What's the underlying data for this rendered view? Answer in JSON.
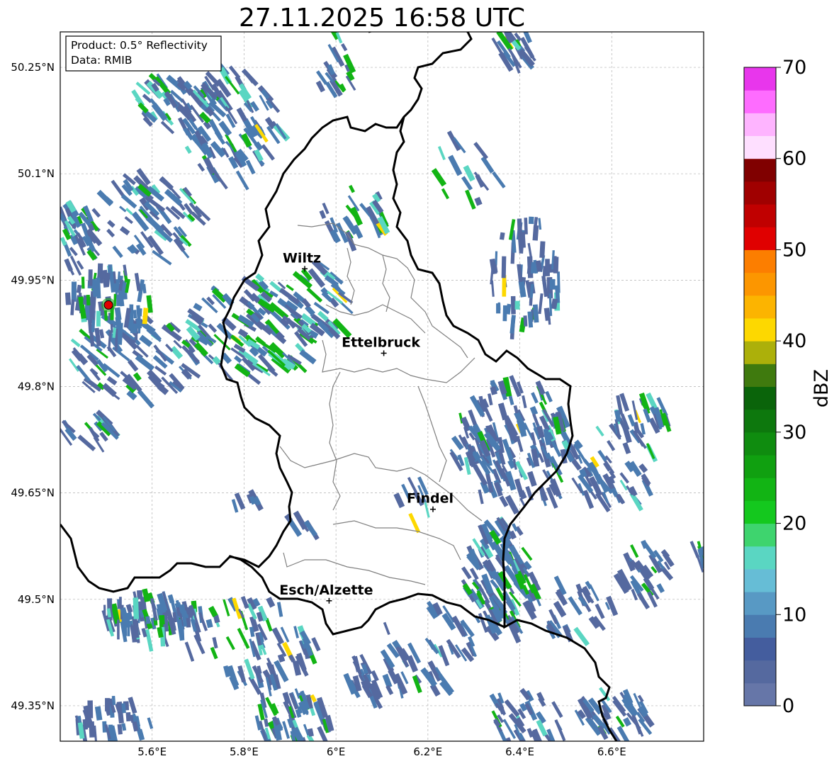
{
  "title": "27.11.2025 16:58 UTC",
  "info_box": {
    "line1": "Product: 0.5° Reflectivity",
    "line2": "Data: RMIB"
  },
  "map": {
    "lon_range": [
      5.4,
      6.8
    ],
    "lat_range": [
      49.3,
      50.3
    ],
    "lon_ticks": [
      {
        "v": 5.6,
        "label": "5.6°E"
      },
      {
        "v": 5.8,
        "label": "5.8°E"
      },
      {
        "v": 6.0,
        "label": "6°E"
      },
      {
        "v": 6.2,
        "label": "6.2°E"
      },
      {
        "v": 6.4,
        "label": "6.4°E"
      },
      {
        "v": 6.6,
        "label": "6.6°E"
      }
    ],
    "lat_ticks": [
      {
        "v": 50.25,
        "label": "50.25°N"
      },
      {
        "v": 50.1,
        "label": "50.1°N"
      },
      {
        "v": 49.95,
        "label": "49.95°N"
      },
      {
        "v": 49.8,
        "label": "49.8°N"
      },
      {
        "v": 49.65,
        "label": "49.65°N"
      },
      {
        "v": 49.5,
        "label": "49.5°N"
      },
      {
        "v": 49.35,
        "label": "49.35°N"
      }
    ],
    "radar_site": {
      "lon": 5.505,
      "lat": 49.915
    },
    "cities": [
      {
        "name": "Wiltz",
        "lon": 5.932,
        "lat": 49.966
      },
      {
        "name": "Ettelbruck",
        "lon": 6.104,
        "lat": 49.847
      },
      {
        "name": "Findel",
        "lon": 6.211,
        "lat": 49.627
      },
      {
        "name": "Esch/Alzette",
        "lon": 5.985,
        "lat": 49.498
      }
    ]
  },
  "colorbar": {
    "label": "dBZ",
    "min": 0,
    "max": 70,
    "ticks": [
      "0",
      "10",
      "20",
      "30",
      "40",
      "50",
      "60",
      "70"
    ],
    "colors": [
      "#6676a8",
      "#55699f",
      "#445d9e",
      "#4a7bb0",
      "#5899c4",
      "#66bdd6",
      "#5ad6c2",
      "#3ed46e",
      "#14c81e",
      "#12b414",
      "#10a010",
      "#0f8c0f",
      "#0d780d",
      "#0a640a",
      "#3f7a0e",
      "#acb00a",
      "#fdd800",
      "#fcb400",
      "#fc9600",
      "#fc7e00",
      "#e00000",
      "#c00000",
      "#a00000",
      "#800000",
      "#fedfff",
      "#feb4ff",
      "#fe6cff",
      "#e836ec"
    ]
  },
  "echo_colors": {
    "weak": "#55699f",
    "light": "#4a7bb0",
    "moderate": "#5ad6c2",
    "strong": "#12b414",
    "yellow": "#fdd800",
    "orange": "#fc7e00"
  }
}
